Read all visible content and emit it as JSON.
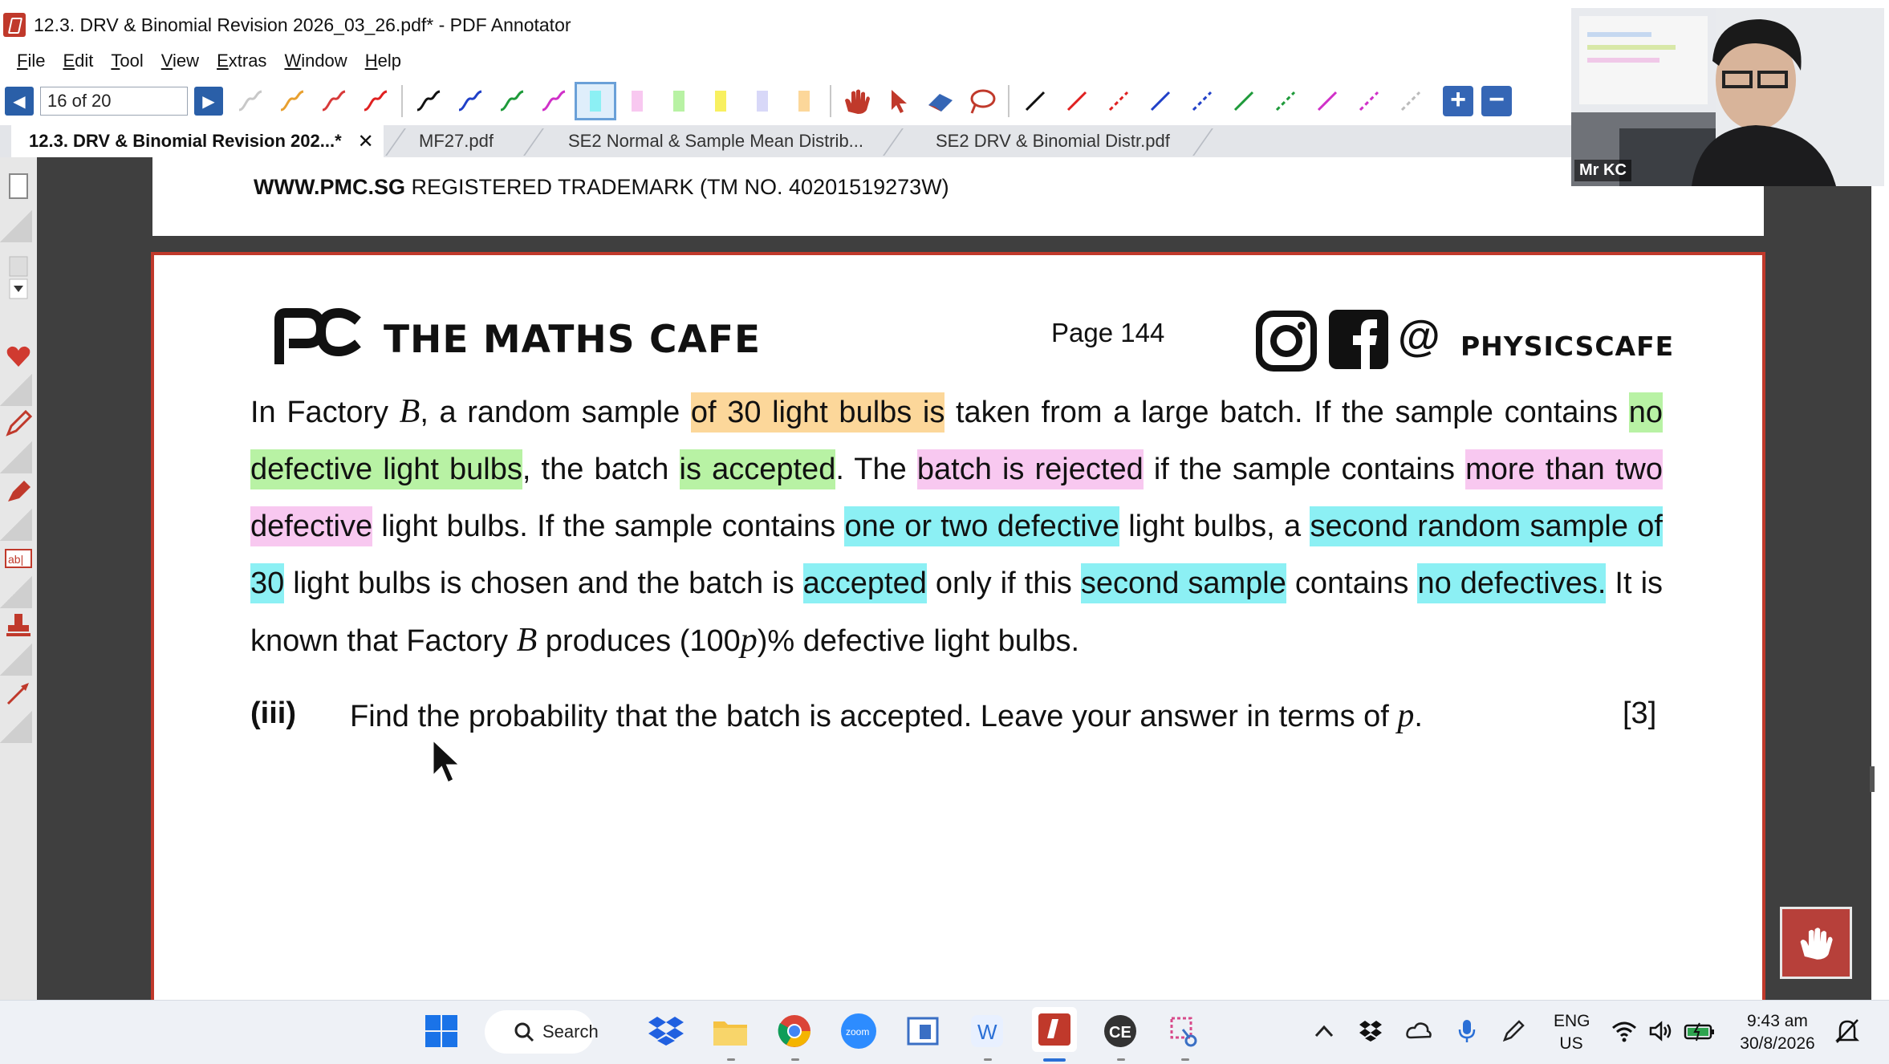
{
  "window": {
    "title": "12.3. DRV & Binomial Revision 2026_03_26.pdf* - PDF Annotator"
  },
  "menu": [
    {
      "label": "File",
      "u": "F",
      "rest": "ile"
    },
    {
      "label": "Edit",
      "u": "E",
      "rest": "dit"
    },
    {
      "label": "Tool",
      "u": "T",
      "rest": "ool"
    },
    {
      "label": "View",
      "u": "V",
      "rest": "iew"
    },
    {
      "label": "Extras",
      "u": "E",
      "rest": "xtras"
    },
    {
      "label": "Window",
      "u": "W",
      "rest": "indow"
    },
    {
      "label": "Help",
      "u": "H",
      "rest": "elp"
    }
  ],
  "toolbar": {
    "page_field": "16 of 20",
    "prev_icon": "triangle-left-icon",
    "next_icon": "triangle-right-icon"
  },
  "tabs": [
    {
      "label": "12.3. DRV & Binomial Revision 202...*",
      "active": true
    },
    {
      "label": "MF27.pdf",
      "active": false
    },
    {
      "label": "SE2 Normal & Sample Mean Distrib...",
      "active": false
    },
    {
      "label": "SE2 DRV & Binomial Distr.pdf",
      "active": false
    }
  ],
  "document": {
    "trademark_bold": "WWW.PMC.SG",
    "trademark_rest": " REGISTERED TRADEMARK (TM NO. 40201519273W)",
    "brand": "THE MATHS CAFE",
    "page_label": "Page 144",
    "at": "@",
    "social_handle": "PHYSICSCAFE",
    "question": {
      "t1": "In Factory ",
      "B1": "B",
      "t2": ", a random sample ",
      "h1": "of 30 light bulbs is",
      "t3": " taken from a large batch. If the sample contains ",
      "h2": "no defective light bulbs",
      "t4": ", the batch ",
      "h3": "is accepted",
      "t5": ". The ",
      "h4": "batch is rejected",
      "t6": " if the sample contains ",
      "h5": "more than two defective",
      "t7": " light bulbs. If the sample contains ",
      "h6": "one or two defective",
      "t8": " light bulbs, a ",
      "h7": "second random sample of 30",
      "t9": " light bulbs is chosen and the batch is ",
      "h8": "accepted",
      "t10": " only if this ",
      "h9": "second sample",
      "t11": " contains ",
      "h10": "no defectives.",
      "t12": " It is known that Factory ",
      "B2": "B",
      "t13": " produces (100",
      "p": "p",
      "t14": ")% defective light bulbs."
    },
    "part": {
      "label": "(iii)",
      "text": "Find the probability that the batch is accepted. Leave your answer in terms of ",
      "p": "p",
      "end": ".",
      "marks": "[3]"
    }
  },
  "webcam": {
    "label": "Mr KC"
  },
  "taskbar": {
    "search": "Search",
    "lang1": "ENG",
    "lang2": "US",
    "time": "9:43 am",
    "date": "30/8/2026",
    "ce_label": "CE",
    "w_label": "W",
    "zoom_label": "zoom"
  },
  "colors": {
    "accent": "#2a5fa8",
    "highlight_orange": "#fcd79a",
    "highlight_green": "#b8f2a4",
    "highlight_pink": "#f8c8f0",
    "highlight_cyan": "#8cf0f4",
    "page_border": "#c0392b"
  }
}
